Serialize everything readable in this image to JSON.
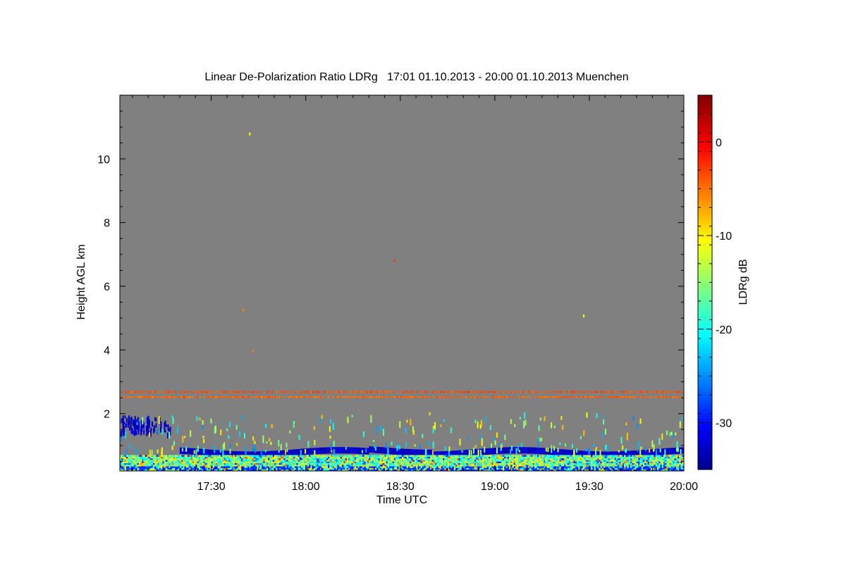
{
  "chart_data": {
    "type": "heatmap",
    "title": "Linear De-Polarization Ratio LDRg   17:01 01.10.2013 - 20:00 01.10.2013 Muenchen",
    "xlabel": "Time UTC",
    "ylabel": "Height AGL km",
    "colorbar_label": "LDRg dB",
    "x_start": "17:01",
    "x_end": "20:00",
    "xlim_minutes_since_1700": [
      1,
      180
    ],
    "x_ticks": [
      {
        "value": 30,
        "label": "17:30"
      },
      {
        "value": 60,
        "label": "18:00"
      },
      {
        "value": 90,
        "label": "18:30"
      },
      {
        "value": 120,
        "label": "19:00"
      },
      {
        "value": 150,
        "label": "19:30"
      },
      {
        "value": 180,
        "label": "20:00"
      }
    ],
    "ylim_km": [
      0.2,
      12.0
    ],
    "y_ticks": [
      {
        "value": 2,
        "label": "2"
      },
      {
        "value": 4,
        "label": "4"
      },
      {
        "value": 6,
        "label": "6"
      },
      {
        "value": 8,
        "label": "8"
      },
      {
        "value": 10,
        "label": "10"
      }
    ],
    "colorbar_range_db": [
      -35,
      5
    ],
    "colorbar_ticks": [
      {
        "value": 0,
        "label": "0"
      },
      {
        "value": -10,
        "label": "-10"
      },
      {
        "value": -20,
        "label": "-20"
      },
      {
        "value": -30,
        "label": "-30"
      }
    ],
    "background_color": "#808080",
    "features": [
      {
        "kind": "layer",
        "name": "upper-depolarizing-layer",
        "height_km": 2.68,
        "ldr_db": -3,
        "t_start": 1,
        "t_end": 180
      },
      {
        "kind": "layer",
        "name": "lower-depolarizing-layer",
        "height_km": 2.52,
        "ldr_db": -4,
        "t_start": 1,
        "t_end": 180
      },
      {
        "kind": "layer",
        "name": "low-ldr-cloud-base",
        "height_km": 0.78,
        "ldr_db": -32,
        "t_start": 20,
        "t_end": 180
      },
      {
        "kind": "patch",
        "name": "early-low-ldr-patch",
        "height_km": [
          1.4,
          1.95
        ],
        "ldr_db": -32,
        "t_start": 1,
        "t_end": 17
      },
      {
        "kind": "boundary-layer",
        "name": "noisy-boundary-layer",
        "height_km": [
          0.2,
          0.7
        ],
        "ldr_db_range": [
          -30,
          -5
        ],
        "t_start": 1,
        "t_end": 180
      }
    ],
    "isolated_points": [
      {
        "t": 42,
        "h": 10.78,
        "ldr_db": -10
      },
      {
        "t": 88,
        "h": 6.8,
        "ldr_db": -2
      },
      {
        "t": 40,
        "h": 5.25,
        "ldr_db": -5
      },
      {
        "t": 43,
        "h": 3.97,
        "ldr_db": -5
      },
      {
        "t": 148,
        "h": 5.07,
        "ldr_db": -10
      }
    ],
    "grid": false,
    "legend": "right-colorbar"
  }
}
